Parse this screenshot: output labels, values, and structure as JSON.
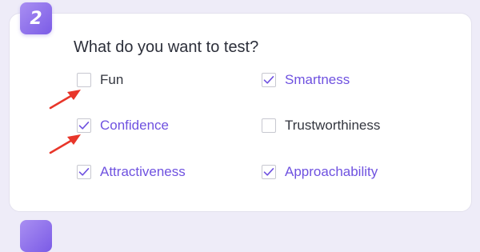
{
  "question": {
    "step_number": "2",
    "title": "What do you want to test?"
  },
  "options": [
    {
      "label": "Fun",
      "checked": false
    },
    {
      "label": "Smartness",
      "checked": true
    },
    {
      "label": "Confidence",
      "checked": true
    },
    {
      "label": "Trustworthiness",
      "checked": false
    },
    {
      "label": "Attractiveness",
      "checked": true
    },
    {
      "label": "Approachability",
      "checked": true
    }
  ],
  "colors": {
    "accent": "#6f52e0",
    "annotation_arrow": "#e8362a",
    "background": "#eeecf8"
  },
  "icons": {
    "check": "check-icon",
    "annotation": "red-arrow-icon"
  }
}
